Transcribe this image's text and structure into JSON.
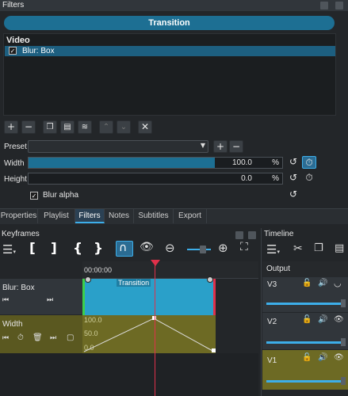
{
  "filters_panel": {
    "title": "Filters",
    "transition_button": "Transition",
    "group_header": "Video",
    "filter_items": [
      {
        "checked": "✓",
        "label": "Blur: Box"
      }
    ],
    "preset_label": "Preset",
    "preset_value": "",
    "params": [
      {
        "label": "Width",
        "value": "100.0",
        "unit": "%",
        "level": 1.0
      },
      {
        "label": "Height",
        "value": "0.0",
        "unit": "%",
        "level": 0.0
      }
    ],
    "blur_alpha": {
      "checked": "✓",
      "label": "Blur alpha"
    }
  },
  "tabs": [
    {
      "label": "Properties",
      "active": false
    },
    {
      "label": "Playlist",
      "active": false
    },
    {
      "label": "Filters",
      "active": true
    },
    {
      "label": "Notes",
      "active": false
    },
    {
      "label": "Subtitles",
      "active": false
    },
    {
      "label": "Export",
      "active": false
    }
  ],
  "keyframes_panel": {
    "title": "Keyframes",
    "timecode": "00:00:00",
    "tracks": [
      {
        "label": "Blur: Box",
        "clip_label": "Transition"
      },
      {
        "label": "Width",
        "axis_labels": [
          "100.0",
          "50.0",
          "0.0"
        ]
      }
    ]
  },
  "timeline_panel": {
    "title": "Timeline",
    "output_label": "Output",
    "tracks": [
      {
        "label": "V3"
      },
      {
        "label": "V2"
      },
      {
        "label": "V1"
      }
    ]
  },
  "colors": {
    "accent": "#1d6f93",
    "keyframe_clip": "#2aa0c9",
    "keyframe_curve_bg": "#6d6a24",
    "playhead": "#e0304a",
    "selected_row": "#1d5f80"
  }
}
